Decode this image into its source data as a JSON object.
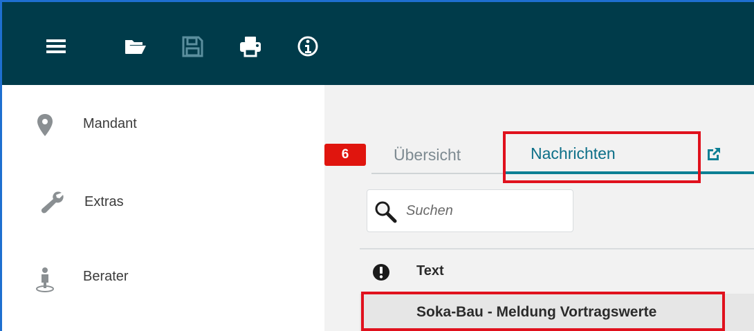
{
  "toolbar": {
    "icons": [
      "menu-icon",
      "folder-open-icon",
      "save-icon",
      "print-icon",
      "info-icon"
    ],
    "color": "#003b4a"
  },
  "sidebar": {
    "items": [
      {
        "label": "Mandant",
        "icon": "map-pin-icon"
      },
      {
        "label": "Extras",
        "icon": "wrench-icon"
      },
      {
        "label": "Berater",
        "icon": "person-icon"
      }
    ]
  },
  "main": {
    "tabs": [
      {
        "label": "Übersicht",
        "active": false
      },
      {
        "label": "Nachrichten",
        "active": true,
        "badge": "6"
      }
    ],
    "search": {
      "placeholder": "Suchen",
      "value": ""
    },
    "list": {
      "header": {
        "priority_icon": "exclamation-icon",
        "text": "Text"
      },
      "rows": [
        {
          "text": "Soka-Bau - Meldung Vortragswerte"
        }
      ]
    }
  },
  "colors": {
    "accent": "#0c7f94",
    "badge": "#e0150e",
    "highlight": "#e0111d"
  }
}
